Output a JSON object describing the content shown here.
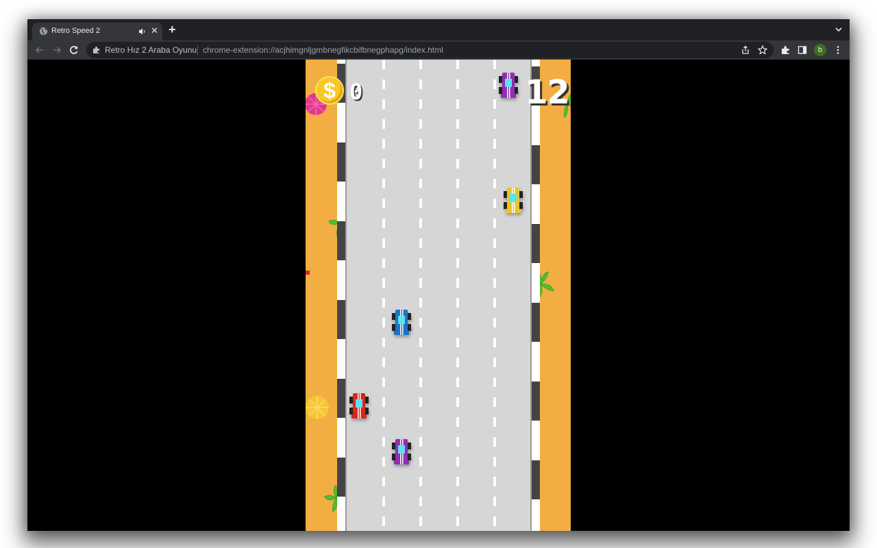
{
  "browser": {
    "tab": {
      "title": "Retro Speed 2",
      "favicon": "globe-icon",
      "audio_icon": "speaker-icon",
      "close_icon": "close-icon"
    },
    "new_tab_icon": "plus-icon",
    "tab_list_icon": "chevron-down-icon",
    "nav": {
      "back_icon": "arrow-left-icon",
      "forward_icon": "arrow-right-icon",
      "reload_icon": "reload-icon"
    },
    "omnibox": {
      "site_name": "Retro Hız 2 Araba Oyunu",
      "url": "chrome-extension://acjhimgnljgmbnegfikcbifbnegphapg/index.html",
      "share_icon": "share-icon",
      "bookmark_icon": "star-icon"
    },
    "extensions_icon": "puzzle-icon",
    "side_panel_icon": "side-panel-icon",
    "profile_initial": "b",
    "profile_color": "#3d6f23",
    "menu_icon": "kebab-menu-icon"
  },
  "game": {
    "coins": "0",
    "score": "12",
    "coin_icon": "dollar-coin-icon",
    "colors": {
      "sand": "#f2ad43",
      "road": "#d6d6d6",
      "curb_dark": "#444444",
      "lane_marking": "#ffffff",
      "car_windshield": "#5ce1f0"
    },
    "cars": [
      {
        "role": "opponent",
        "color": "#8e2fb5",
        "lane": 4
      },
      {
        "role": "opponent",
        "color": "#e6c72a",
        "lane": 4
      },
      {
        "role": "opponent",
        "color": "#1e73c8",
        "lane": 2
      },
      {
        "role": "player",
        "color": "#d42a1e",
        "lane": 1
      },
      {
        "role": "opponent",
        "color": "#8e2fb5",
        "lane": 2
      }
    ],
    "decorations": [
      "pink-umbrella-icon",
      "palm-tree-icon",
      "palm-tree-icon",
      "palm-tree-icon",
      "yellow-umbrella-icon",
      "palm-tree-icon"
    ]
  }
}
